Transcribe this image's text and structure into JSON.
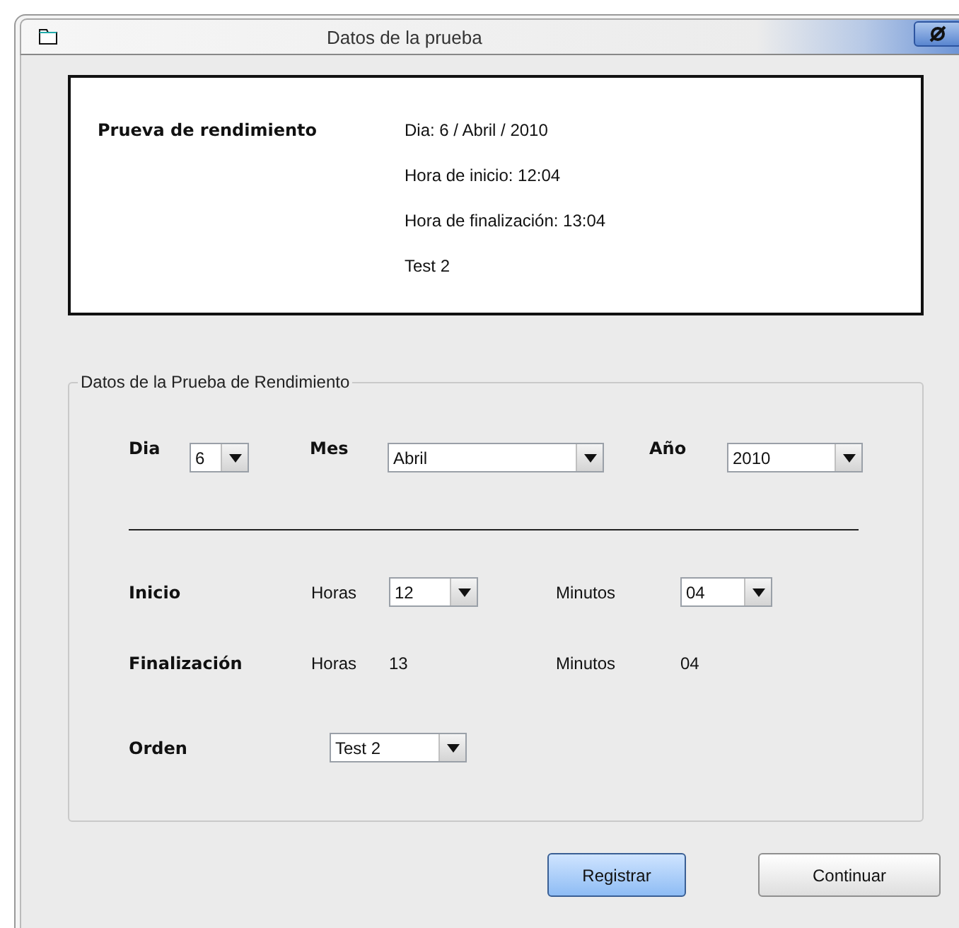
{
  "window": {
    "title": "Datos de la prueba"
  },
  "summary": {
    "heading": "Prueva de rendimiento",
    "lines": [
      "Dia:  6 / Abril / 2010",
      "Hora de inicio:  12:04",
      "Hora de finalización:  13:04",
      "Test 2"
    ]
  },
  "group": {
    "legend": "Datos de la Prueba de Rendimiento",
    "date": [
      {
        "label": "Dia",
        "value": "6"
      },
      {
        "label": "Mes",
        "value": "Abril"
      },
      {
        "label": "Año",
        "value": "2010"
      }
    ],
    "start": {
      "label": "Inicio",
      "hours_label": "Horas",
      "hours": "12",
      "minutes_label": "Minutos",
      "minutes": "04"
    },
    "end": {
      "label": "Finalización",
      "hours_label": "Horas",
      "hours": "13",
      "minutes_label": "Minutos",
      "minutes": "04"
    },
    "order": {
      "label": "Orden",
      "value": "Test 2"
    }
  },
  "buttons": [
    {
      "label": "Registrar",
      "default": true
    },
    {
      "label": "Continuar",
      "default": false
    }
  ]
}
